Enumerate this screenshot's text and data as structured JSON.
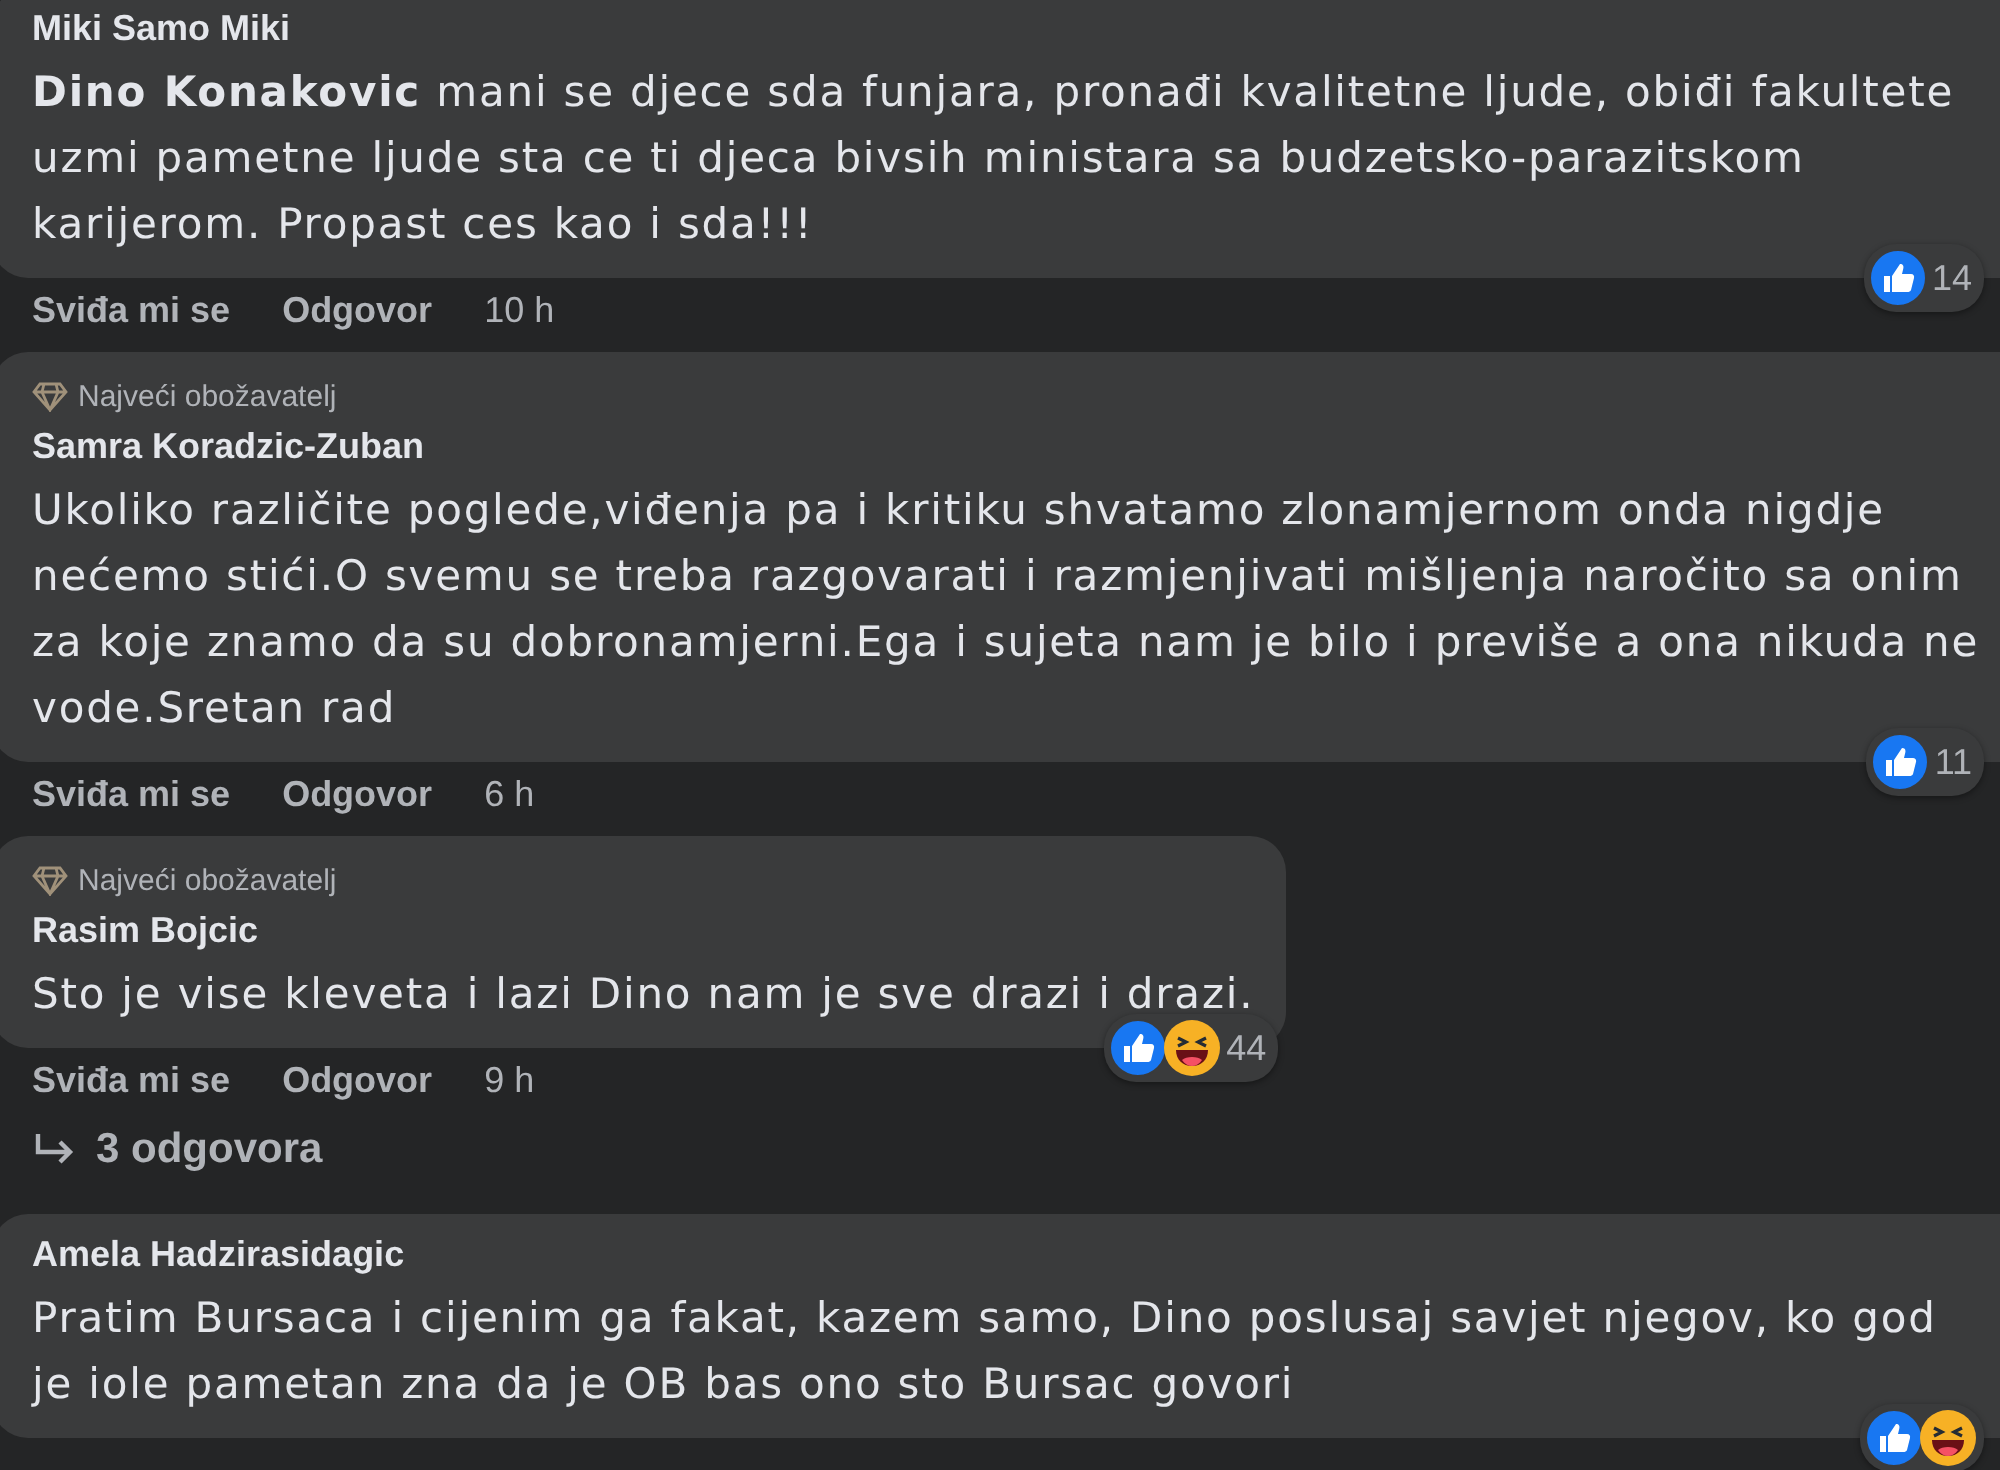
{
  "comments": [
    {
      "author": "Miki Samo Miki",
      "text": "**Dino Konakovic** mani se djece sda funjara, pronađi kvalitetne ljude, obiđi fakultete uzmi pametne ljude sta ce ti djeca bivsih ministara sa budzetsko-parazitskom karijerom. Propast ces kao i sda!!!",
      "wide": true,
      "reactions": [
        {
          "kind": "like"
        }
      ],
      "reaction_count": "14",
      "actions": [
        "Sviđa mi se",
        "Odgovor"
      ],
      "time": "10 h"
    },
    {
      "badge": "Najveći obožavatelj",
      "author": "Samra Koradzic-Zuban",
      "text": "Ukoliko različite poglede,viđenja pa i kritiku shvatamo zlonamjernom onda nigdje nećemo stići.O svemu se treba razgovarati i razmjenjivati mišljenja naročito sa onim za koje znamo da su dobronamjerni.Ega i sujeta nam je bilo i previše a ona nikuda ne vode.Sretan rad",
      "wide": true,
      "reactions": [
        {
          "kind": "like"
        }
      ],
      "reaction_count": "11",
      "actions": [
        "Sviđa mi se",
        "Odgovor"
      ],
      "time": "6 h"
    },
    {
      "badge": "Najveći obožavatelj",
      "author": "Rasim Bojcic",
      "text": "Sto je vise kleveta i lazi Dino nam je sve drazi i drazi.",
      "wide": false,
      "reactions": [
        {
          "kind": "like"
        },
        {
          "kind": "haha"
        }
      ],
      "reaction_count": "44",
      "actions": [
        "Sviđa mi se",
        "Odgovor"
      ],
      "time": "9 h",
      "replies": "3 odgovora"
    },
    {
      "author": "Amela Hadzirasidagic",
      "text": "Pratim Bursaca i cijenim ga fakat, kazem samo, Dino poslusaj savjet njegov, ko god je iole pametan zna da je OB bas ono sto Bursac govori",
      "wide": true,
      "reactions": [
        {
          "kind": "like"
        },
        {
          "kind": "haha"
        }
      ]
    }
  ]
}
